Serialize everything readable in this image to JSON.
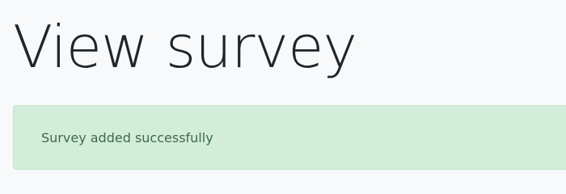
{
  "header": {
    "title": "View survey"
  },
  "alert": {
    "message": "Survey added successfully",
    "type": "success",
    "colors": {
      "background": "#d4edda",
      "border": "#c3e6cb",
      "text": "#3f6b4a"
    }
  }
}
